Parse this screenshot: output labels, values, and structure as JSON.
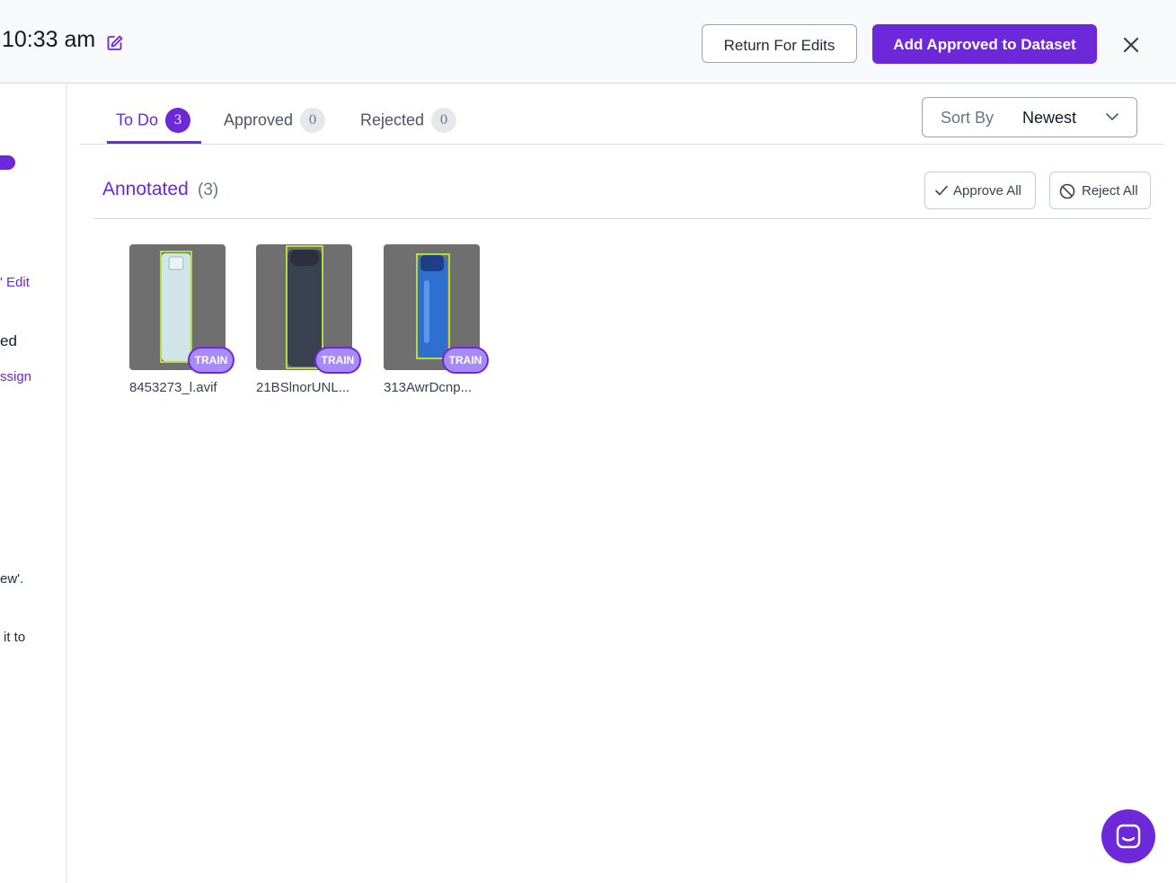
{
  "header": {
    "title": "10:33 am",
    "return_label": "Return For Edits",
    "add_label": "Add Approved to Dataset"
  },
  "sidebar": {
    "texts": [
      "' Edit",
      "ed",
      "ssign",
      "ew'.",
      "it to"
    ]
  },
  "tabs": [
    {
      "label": "To Do",
      "count": "3",
      "active": true
    },
    {
      "label": "Approved",
      "count": "0",
      "active": false
    },
    {
      "label": "Rejected",
      "count": "0",
      "active": false
    }
  ],
  "sort": {
    "label": "Sort By",
    "value": "Newest"
  },
  "section": {
    "title": "Annotated",
    "count": "(3)",
    "approve_all": "Approve All",
    "reject_all": "Reject All"
  },
  "images": [
    {
      "name": "8453273_l.avif",
      "tag": "TRAIN",
      "bottle_color": "#c8e0e4"
    },
    {
      "name": "21BSlnorUNL...",
      "tag": "TRAIN",
      "bottle_color": "#3a4150"
    },
    {
      "name": "313AwrDcnp...",
      "tag": "TRAIN",
      "bottle_color": "#2f6fd0"
    }
  ],
  "colors": {
    "accent": "#6d28d9",
    "badge_train": "#a78bfa",
    "annotation_box": "#c8ff3c"
  }
}
